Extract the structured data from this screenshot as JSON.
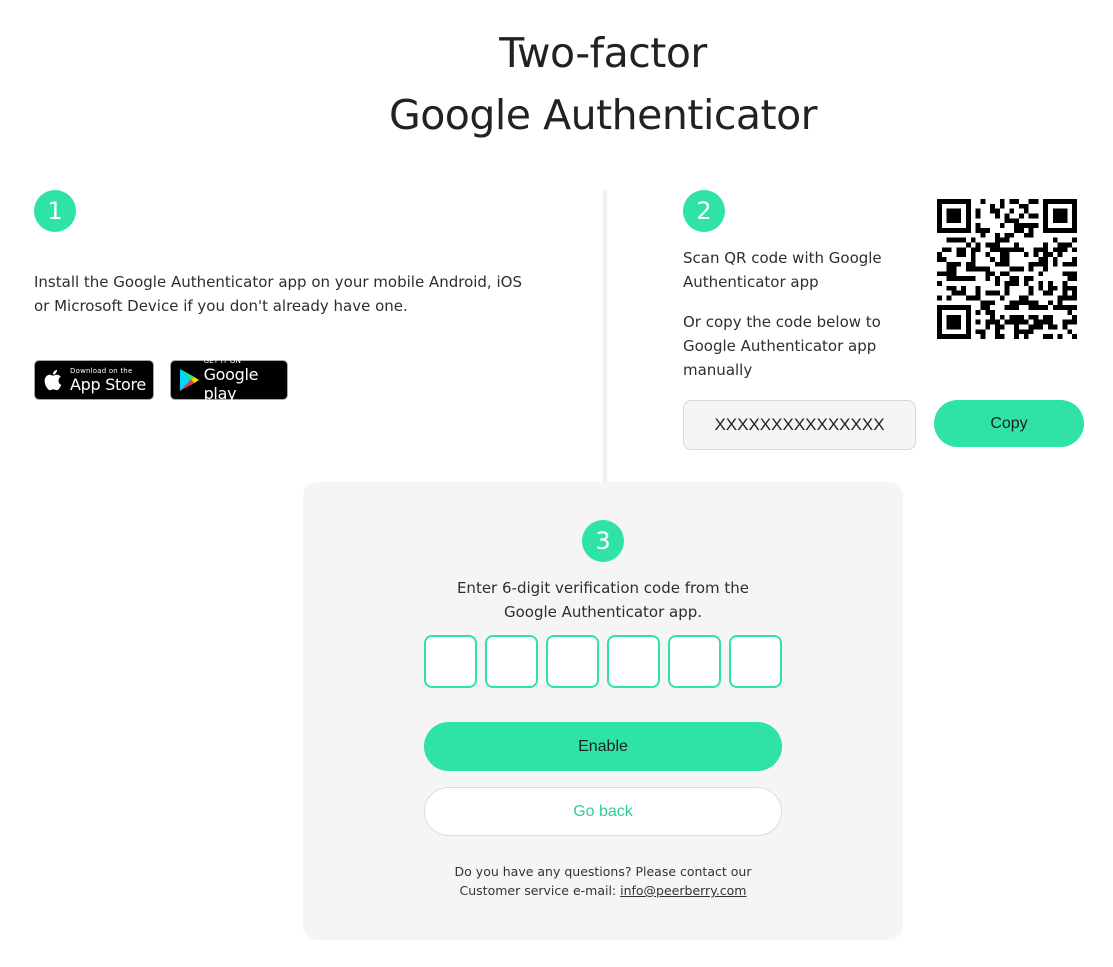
{
  "header": {
    "title_line1": "Two-factor",
    "title_line2": "Google Authenticator"
  },
  "colors": {
    "accent": "#2ee3a3",
    "panel_bg": "#f5f5f5",
    "link_green": "#2ecf96"
  },
  "step1": {
    "number": "1",
    "description": "Install the Google Authenticator app on your mobile Android, iOS or Microsoft Device if you don't already have one.",
    "app_store": {
      "small": "Download on the",
      "big": "App Store",
      "icon": "apple-icon"
    },
    "google_play": {
      "small": "GET IT ON",
      "big": "Google play",
      "icon": "play-triangle-icon"
    }
  },
  "step2": {
    "number": "2",
    "scan_text": "Scan QR code with Google Authenticator app",
    "copy_text": "Or copy the code below to Google Authenticator app manually",
    "code_value": "XXXXXXXXXXXXXXX",
    "copy_label": "Copy"
  },
  "step3": {
    "number": "3",
    "instruction": "Enter 6-digit verification code from the Google Authenticator app.",
    "enable_label": "Enable",
    "back_label": "Go back",
    "footer_line1": "Do you have any questions? Please contact our",
    "footer_line2_prefix": "Customer service e-mail: ",
    "footer_email": "info@peerberry.com"
  }
}
